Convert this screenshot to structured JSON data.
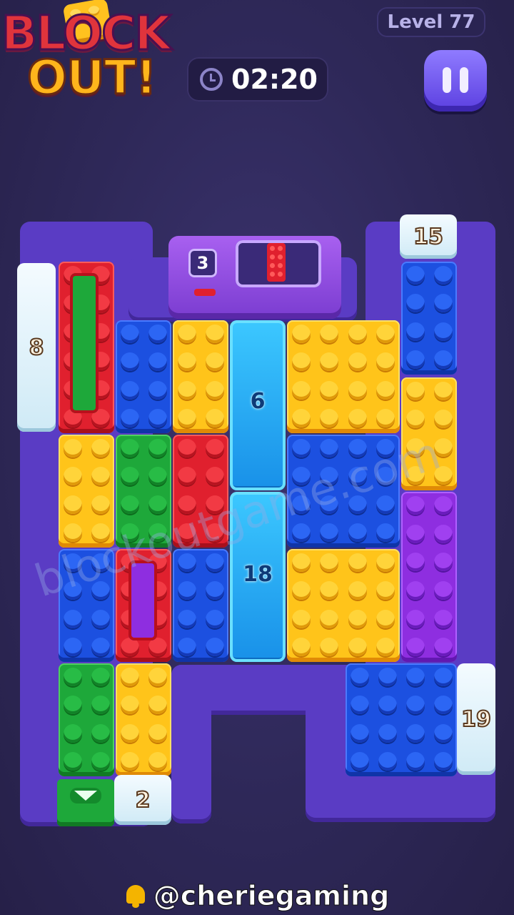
{
  "logo": {
    "line1": "BLOCK",
    "line2": "OUT!"
  },
  "header": {
    "level": "Level 77",
    "timer": "02:20"
  },
  "machine": {
    "counter": "3"
  },
  "gates": {
    "g8": "8",
    "g15": "15",
    "g19": "19",
    "g2": "2"
  },
  "ice": {
    "top": "6",
    "bottom": "18"
  },
  "watermark": "blockoutgame.com",
  "footer": {
    "handle": "@cheriegaming"
  },
  "icons": [
    "clock-icon",
    "pause-icon",
    "bell-icon",
    "down-arrow-icon"
  ],
  "colors": {
    "red": "#e0202e",
    "blue": "#1c50e0",
    "yellow": "#ffc41a",
    "green": "#1ea83a",
    "purple": "#8e2ee0",
    "board": "#5a3cc4"
  }
}
